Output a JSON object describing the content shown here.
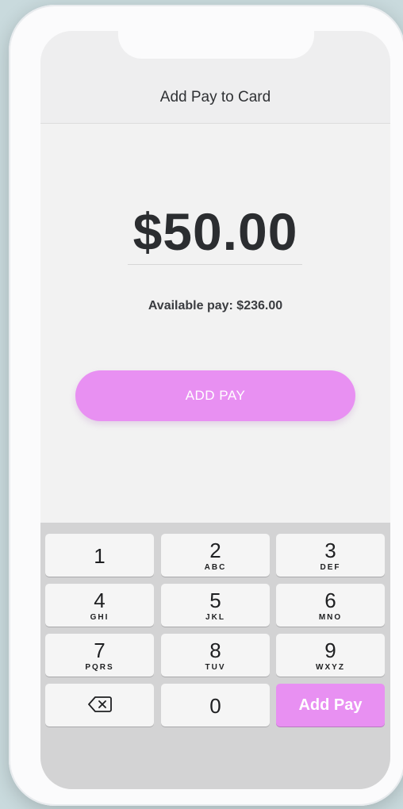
{
  "header": {
    "title": "Add Pay to Card"
  },
  "main": {
    "amount": "$50.00",
    "available_text": "Available pay: $236.00",
    "add_pay_button": "ADD PAY"
  },
  "keypad": {
    "keys": [
      {
        "num": "1",
        "letters": ""
      },
      {
        "num": "2",
        "letters": "ABC"
      },
      {
        "num": "3",
        "letters": "DEF"
      },
      {
        "num": "4",
        "letters": "GHI"
      },
      {
        "num": "5",
        "letters": "JKL"
      },
      {
        "num": "6",
        "letters": "MNO"
      },
      {
        "num": "7",
        "letters": "PQRS"
      },
      {
        "num": "8",
        "letters": "TUV"
      },
      {
        "num": "9",
        "letters": "WXYZ"
      },
      {
        "num": "0",
        "letters": ""
      }
    ],
    "backspace_icon": "backspace-icon",
    "action_label": "Add Pay"
  },
  "colors": {
    "accent": "#e890f2",
    "background": "#f2f2f2",
    "keypad_bg": "#d3d3d4",
    "text": "#2b2d30"
  }
}
